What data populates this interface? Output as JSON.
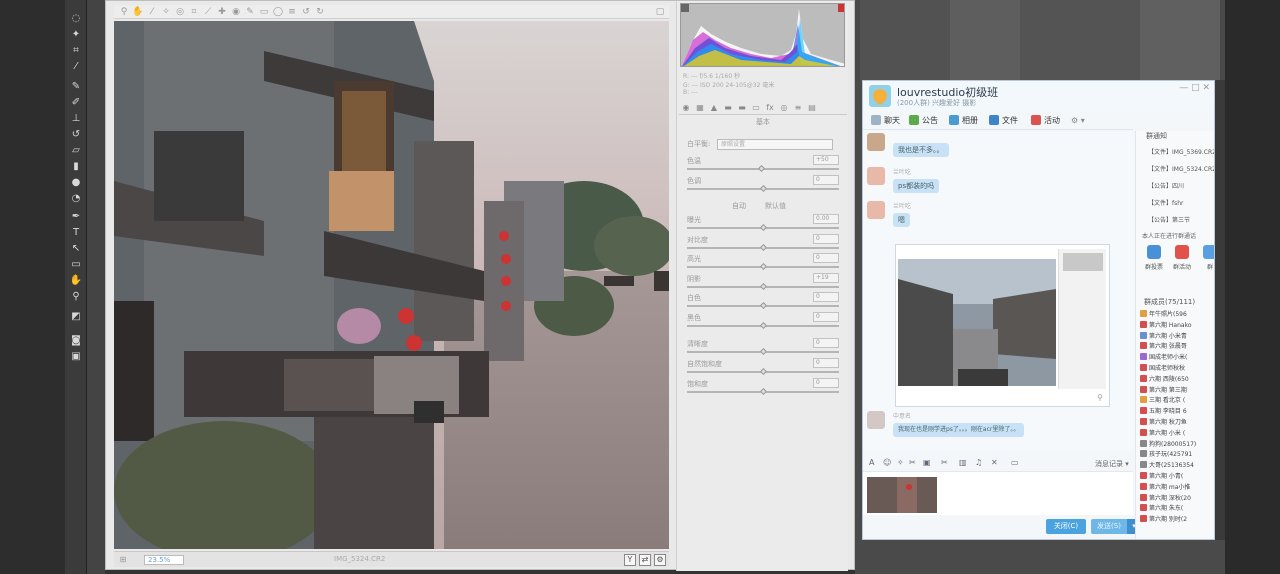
{
  "acr": {
    "file_label": "IMG_5324.CR2",
    "zoom": "23.5%",
    "readout_line1": "R: ---   f/5.6  1/160 秒",
    "readout_line2": "G: ---   ISO 200  24-105@32 毫米",
    "readout_line3": "B: ---",
    "panel_title": "基本",
    "white_balance_label": "白平衡:",
    "white_balance_value": "原照设置",
    "temp_label": "色温",
    "temp_value": "+50",
    "tint_label": "色调",
    "tint_value": "0",
    "auto_label": "自动",
    "default_label": "默认值",
    "sliders": [
      {
        "label": "曝光",
        "value": "0.00"
      },
      {
        "label": "对比度",
        "value": "0"
      },
      {
        "label": "高光",
        "value": "0"
      },
      {
        "label": "阴影",
        "value": "+19"
      },
      {
        "label": "白色",
        "value": "0"
      },
      {
        "label": "黑色",
        "value": "0"
      }
    ],
    "sliders2": [
      {
        "label": "清晰度",
        "value": "0"
      },
      {
        "label": "自然饱和度",
        "value": "0"
      },
      {
        "label": "饱和度",
        "value": "0"
      }
    ],
    "histogram_colors": [
      "#ffd400",
      "#c000c0",
      "#1a3bd8",
      "#00b8ff",
      "#ffffff"
    ]
  },
  "qq": {
    "group_name": "louvrestudio初级班",
    "group_sub": "(200人群) 兴趣爱好 摄影",
    "win_controls": "— □ ✕",
    "nav": [
      "聊天",
      "公告",
      "相册",
      "文件",
      "活动"
    ],
    "messages": [
      {
        "sender": "",
        "text": "我也是不多。。"
      },
      {
        "sender": "兰叶吃",
        "text": "ps都装的吗"
      },
      {
        "sender": "兰叶吃",
        "text": "嗯"
      },
      {
        "sender": "中意名",
        "text": "我现在也是刚学进ps了。。。刚在acr里除了。。"
      }
    ],
    "history_label": "消息记录 ▾",
    "close_button": "关闭(C)",
    "send_button": "发送(S)",
    "send_arrow": "▾",
    "side": {
      "notice_title": "群通知",
      "notices": [
        "【文件】IMG_5369.CR2",
        "【文件】IMG_5324.CR2",
        "【公告】四川",
        "【文件】fshr",
        "【公告】第三节"
      ],
      "ongoing": "本人正在进行群通话",
      "apps": [
        "群投票",
        "群活动",
        "群"
      ],
      "members_title": "群成员(75/111)",
      "members": [
        "年牛照片(596",
        "第六期 Hanako",
        "第六期 小米青",
        "第六期 张晨哥",
        "国成老师小米(",
        "国成老师秋秋",
        "六期 西陵(650",
        "第六期 第三期",
        "三期 看北京 (",
        "五期 李晓目 6",
        "第六期 秋刀鱼",
        "第六期 小米 (",
        "狗狗(28000517)",
        "孩子玩(425791",
        "大哥(25136354",
        "第六期 小青(",
        "第六期 ma小推",
        "第六期 深秋(20",
        "第六期 朱东(",
        "第六期 别时(2"
      ]
    }
  }
}
